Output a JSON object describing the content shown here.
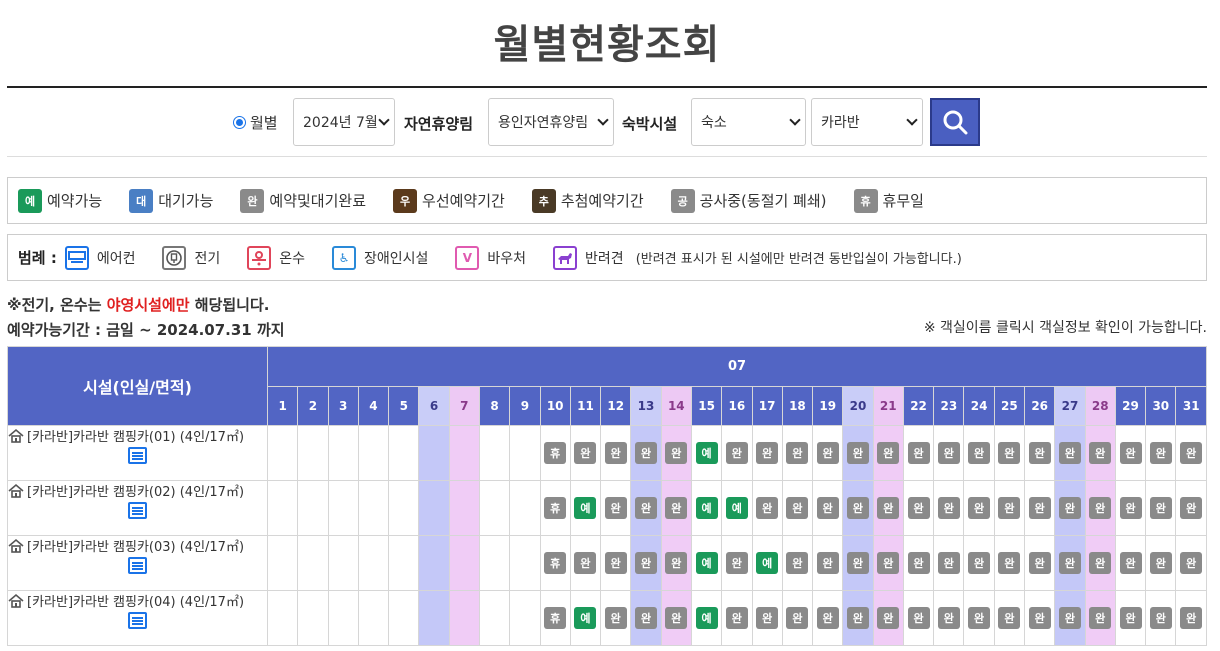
{
  "title": "월별현황조회",
  "search": {
    "radio_label": "월별",
    "month_value": "2024년 7월",
    "forest_label": "자연휴양림",
    "forest_value": "용인자연휴양림",
    "lodging_label": "숙박시설",
    "lodging_type_value": "숙소",
    "lodging_sub_value": "카라반"
  },
  "status_legend": [
    {
      "badge": "예",
      "label": "예약가능",
      "color": "#1a9a5a"
    },
    {
      "badge": "대",
      "label": "대기가능",
      "color": "#4a7fc4"
    },
    {
      "badge": "완",
      "label": "예약및대기완료",
      "color": "#8a8a8a"
    },
    {
      "badge": "우",
      "label": "우선예약기간",
      "color": "#5b3a1c"
    },
    {
      "badge": "추",
      "label": "추첨예약기간",
      "color": "#4a3a26"
    },
    {
      "badge": "공",
      "label": "공사중(동절기 폐쇄)",
      "color": "#8a8a8a"
    },
    {
      "badge": "휴",
      "label": "휴무일",
      "color": "#8a8a8a"
    }
  ],
  "icon_legend": {
    "heading": "범례 :",
    "items": [
      {
        "icon": "aircon-icon",
        "label": "에어컨"
      },
      {
        "icon": "electric-icon",
        "label": "전기"
      },
      {
        "icon": "hot-water-icon",
        "label": "온수"
      },
      {
        "icon": "accessible-icon",
        "label": "장애인시설"
      },
      {
        "icon": "voucher-icon",
        "label": "바우처"
      },
      {
        "icon": "pet-icon",
        "label": "반려견"
      }
    ],
    "note": "(반려견 표시가 된 시설에만 반려견 동반입실이 가능합니다.)"
  },
  "notes": {
    "line1_prefix": "※전기, 온수는 ",
    "line1_red": "야영시설에만",
    "line1_suffix": " 해당됩니다.",
    "line2": "예약가능기간 : 금일 ~ 2024.07.31 까지",
    "line3": "※ 객실이름 클릭시 객실정보 확인이 가능합니다."
  },
  "table": {
    "facility_header": "시설(인실/면적)",
    "month_header": "07",
    "days": [
      "1",
      "2",
      "3",
      "4",
      "5",
      "6",
      "7",
      "8",
      "9",
      "10",
      "11",
      "12",
      "13",
      "14",
      "15",
      "16",
      "17",
      "18",
      "19",
      "20",
      "21",
      "22",
      "23",
      "24",
      "25",
      "26",
      "27",
      "28",
      "29",
      "30",
      "31"
    ],
    "saturdays": [
      6,
      13,
      20,
      27
    ],
    "sundays": [
      7,
      14,
      21,
      28
    ],
    "rows": [
      {
        "name": "[카라반]카라반 캠핑카(01) (4인/17㎡)",
        "cells": [
          "",
          "",
          "",
          "",
          "",
          "",
          "",
          "",
          "",
          "휴",
          "완",
          "완",
          "완",
          "완",
          "예",
          "완",
          "완",
          "완",
          "완",
          "완",
          "완",
          "완",
          "완",
          "완",
          "완",
          "완",
          "완",
          "완",
          "완",
          "완",
          "완"
        ]
      },
      {
        "name": "[카라반]카라반 캠핑카(02) (4인/17㎡)",
        "cells": [
          "",
          "",
          "",
          "",
          "",
          "",
          "",
          "",
          "",
          "휴",
          "예",
          "완",
          "완",
          "완",
          "예",
          "예",
          "완",
          "완",
          "완",
          "완",
          "완",
          "완",
          "완",
          "완",
          "완",
          "완",
          "완",
          "완",
          "완",
          "완",
          "완"
        ]
      },
      {
        "name": "[카라반]카라반 캠핑카(03) (4인/17㎡)",
        "cells": [
          "",
          "",
          "",
          "",
          "",
          "",
          "",
          "",
          "",
          "휴",
          "완",
          "완",
          "완",
          "완",
          "예",
          "완",
          "예",
          "완",
          "완",
          "완",
          "완",
          "완",
          "완",
          "완",
          "완",
          "완",
          "완",
          "완",
          "완",
          "완",
          "완"
        ]
      },
      {
        "name": "[카라반]카라반 캠핑카(04) (4인/17㎡)",
        "cells": [
          "",
          "",
          "",
          "",
          "",
          "",
          "",
          "",
          "",
          "휴",
          "예",
          "완",
          "완",
          "완",
          "예",
          "완",
          "완",
          "완",
          "완",
          "완",
          "완",
          "완",
          "완",
          "완",
          "완",
          "완",
          "완",
          "완",
          "완",
          "완",
          "완"
        ]
      }
    ]
  }
}
